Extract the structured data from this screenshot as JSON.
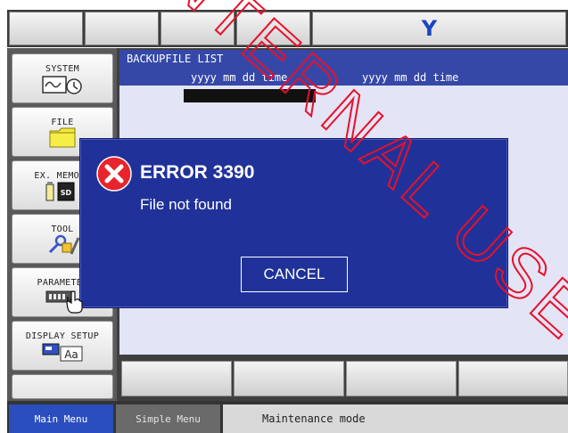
{
  "header": {
    "title": "Y"
  },
  "sidebar": {
    "items": [
      {
        "label": "SYSTEM",
        "icon": "system-monitor-clock-icon"
      },
      {
        "label": "FILE",
        "icon": "folder-icon"
      },
      {
        "label": "EX. MEMORY",
        "icon": "sd-card-icon"
      },
      {
        "label": "TOOL",
        "icon": "wrench-tools-icon"
      },
      {
        "label": "PARAMETER",
        "icon": "parameter-chip-icon"
      },
      {
        "label": "DISPLAY SETUP",
        "icon": "display-text-icon"
      }
    ]
  },
  "main": {
    "list_title": "BACKUPFILE LIST",
    "col_head_1": "yyyy mm dd  time",
    "col_head_2": "yyyy mm dd  time"
  },
  "dialog": {
    "title": "ERROR 3390",
    "message": "File not found",
    "cancel_label": "CANCEL",
    "icon": "error-x-icon"
  },
  "footer": {
    "main_menu_label": "Main Menu",
    "simple_menu_label": "Simple Menu",
    "status": "Maintenance mode"
  },
  "watermark": {
    "text": "INTERNAL USE"
  },
  "colors": {
    "dialog_bg": "#203299",
    "header_blue": "#3548a8",
    "title_blue": "#1a44c2",
    "error_red": "#e8242c",
    "watermark_red": "#e8102a"
  }
}
